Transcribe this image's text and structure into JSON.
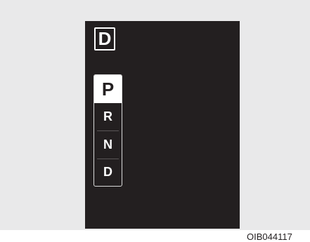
{
  "display": {
    "current_gear": "D",
    "gears": [
      "P",
      "R",
      "N",
      "D"
    ],
    "selected_gear": "P"
  },
  "image_code": "OIB044117"
}
